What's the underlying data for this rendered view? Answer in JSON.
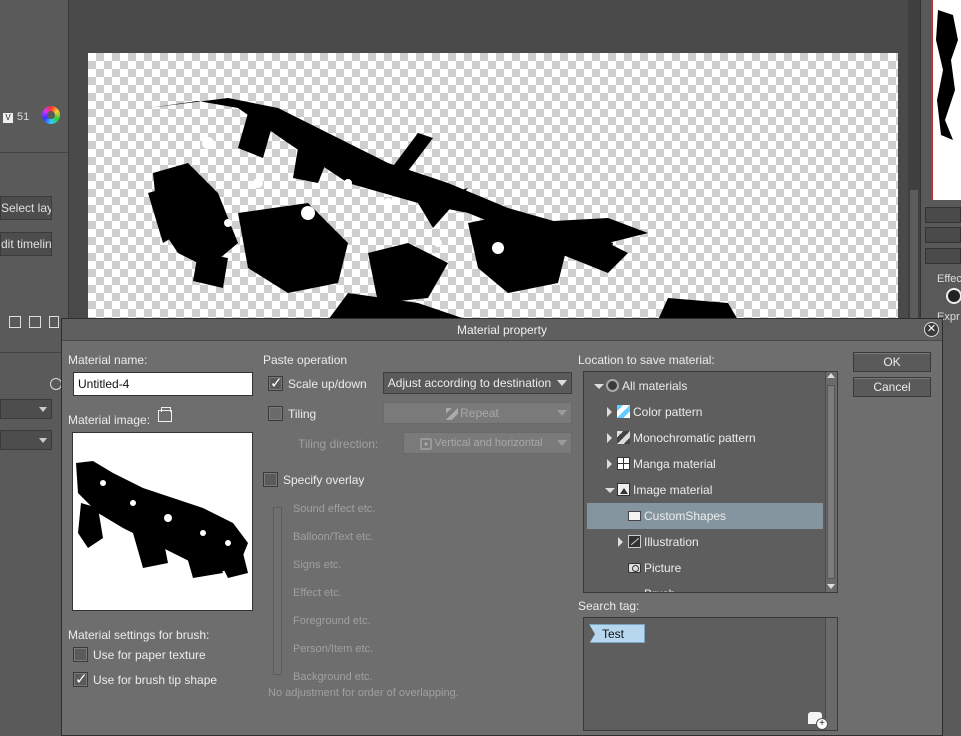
{
  "app": {
    "left_panel": {
      "counter": "51",
      "counter_badge": "V",
      "select_layer_label": "Select layer",
      "edit_timeline_label": "dit timeline"
    },
    "right_panel": {
      "effect_label": "Effec",
      "expr_label": "Expr"
    }
  },
  "dialog": {
    "title": "Material property",
    "material_name_label": "Material name:",
    "material_name_value": "Untitled-4",
    "material_image_label": "Material image:",
    "brush_settings_label": "Material settings for brush:",
    "use_paper_texture": {
      "label": "Use for paper texture",
      "checked": false
    },
    "use_brush_tip": {
      "label": "Use for brush tip shape",
      "checked": true
    },
    "paste_operation_label": "Paste operation",
    "scale_up_down": {
      "label": "Scale up/down",
      "checked": true
    },
    "scale_mode": "Adjust according to destination",
    "tiling": {
      "label": "Tiling",
      "checked": false
    },
    "tiling_mode": "Repeat",
    "tiling_direction_label": "Tiling direction:",
    "tiling_direction_value": "Vertical and horizontal",
    "specify_overlay": {
      "label": "Specify overlay",
      "checked": false
    },
    "overlay_items": [
      "Sound effect etc.",
      "Balloon/Text etc.",
      "Signs etc.",
      "Effect etc.",
      "Foreground etc.",
      "Person/Item etc.",
      "Background etc."
    ],
    "overlay_note": "No adjustment for order of overlapping.",
    "location_label": "Location to save material:",
    "tree": [
      {
        "label": "All materials",
        "icon": "all-materials-icon",
        "indent": 0,
        "expander": "down",
        "selected": false
      },
      {
        "label": "Color pattern",
        "icon": "color-pattern-icon",
        "indent": 1,
        "expander": "right",
        "selected": false
      },
      {
        "label": "Monochromatic pattern",
        "icon": "monochrome-pattern-icon",
        "indent": 1,
        "expander": "right",
        "selected": false
      },
      {
        "label": "Manga material",
        "icon": "manga-material-icon",
        "indent": 1,
        "expander": "right",
        "selected": false
      },
      {
        "label": "Image material",
        "icon": "image-material-icon",
        "indent": 1,
        "expander": "down",
        "selected": false
      },
      {
        "label": "CustomShapes",
        "icon": "folder-icon",
        "indent": 2,
        "expander": "none",
        "selected": true
      },
      {
        "label": "Illustration",
        "icon": "illustration-icon",
        "indent": 2,
        "expander": "right",
        "selected": false
      },
      {
        "label": "Picture",
        "icon": "camera-icon",
        "indent": 2,
        "expander": "none",
        "selected": false
      },
      {
        "label": "Brush",
        "icon": "brush-icon",
        "indent": 2,
        "expander": "none",
        "selected": false
      }
    ],
    "search_tag_label": "Search tag:",
    "tags": [
      "Test"
    ],
    "ok_label": "OK",
    "cancel_label": "Cancel"
  }
}
